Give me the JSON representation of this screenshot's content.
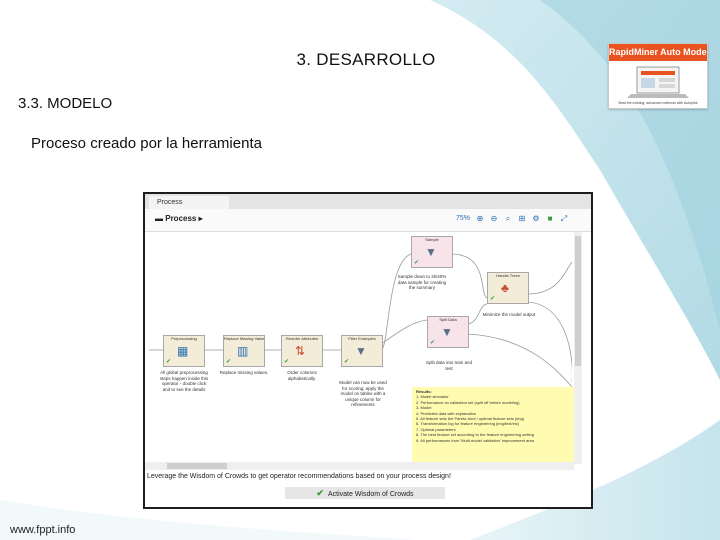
{
  "slide": {
    "title": "3. DESARROLLO",
    "subtitle": "3.3. MODELO",
    "caption": "Proceso creado por la herramienta",
    "footer": "www.fppt.info"
  },
  "logo": {
    "title": "RapidMiner Auto Model",
    "tagline": "Beat the existing, advanced methods with Autopilot"
  },
  "app": {
    "tab": "Process",
    "breadcrumb": "Process",
    "zoom": "75%",
    "hint": "Leverage the Wisdom of Crowds to get operator recommendations based on your process design!",
    "wisdom_button": "Activate Wisdom of Crowds"
  },
  "operators": [
    {
      "name": "Preprocessing",
      "note": "All global preprocessing steps happen inside this operator - double click and to see the details"
    },
    {
      "name": "Replace Missing Values",
      "note": "Replace missing values."
    },
    {
      "name": "Reorder Attributes",
      "note": "Order columns alphabetically."
    },
    {
      "name": "Filter Examples",
      "note": "Model can now be used for scoring; apply the model on tables with a unique column for refinements"
    },
    {
      "name": "Sample",
      "note": "Sample down to 2k/40% data sample for creating the summary"
    },
    {
      "name": "Split Data",
      "note": "Split data into train and test"
    },
    {
      "name": "Handle Trees",
      "note": "Minimize the model output"
    }
  ],
  "results": {
    "title": "Results:",
    "lines": [
      "1. Model simulator",
      "2. Performance on validation set (split off before modeling)",
      "3. Model",
      "4. Predicted data with explanation",
      "5. All feature sets the Pareto-front / optimal feature sets (img)",
      "6. Transformation log for feature engineering (img/text/etc)",
      "7. Optimal parameters",
      "8. The best feature set according to the feature engineering setting",
      "9. All performances from 'Multi-model validation' improvement area"
    ]
  },
  "icons": [
    "zoom-in-icon",
    "zoom-out-icon",
    "search-icon",
    "fit-icon",
    "layout-icon",
    "comment-icon",
    "expand-icon"
  ],
  "colors": {
    "logo_bar": "#e8531f",
    "results_bg": "#fffbb0",
    "operator_bg": "#f3ecd9",
    "operator_pink": "#f7e3ea",
    "ok_check": "#3a9a3a"
  }
}
